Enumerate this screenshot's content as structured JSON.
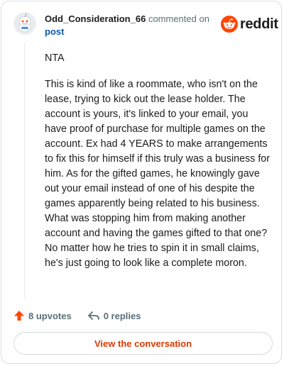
{
  "comment": {
    "username": "Odd_Consideration_66",
    "action_text": "commented on",
    "post_link": "post",
    "paragraphs": [
      "NTA",
      "This is kind of like a roommate, who isn't on the lease, trying to kick out the lease holder. The account is yours, it's linked to your email, you have proof of purchase for multiple games on the account. Ex had 4 YEARS to make arrangements to fix this for himself if this truly was a business for him. As for the gifted games, he knowingly gave out your email instead of one of his despite the games apparently being related to his business. What was stopping him from making another account and having the games gifted to that one? No matter how he tries to spin it in small claims, he's just going to look like a complete moron."
    ]
  },
  "brand": {
    "name": "reddit",
    "icon": "reddit-alien-icon",
    "color": "#ff4500"
  },
  "actions": {
    "upvotes": "8 upvotes",
    "replies": "0 replies",
    "upvote_icon": "upvote-arrow-icon",
    "reply_icon": "reply-arrow-icon",
    "upvote_color": "#ff4500"
  },
  "cta": {
    "label": "View the conversation",
    "color": "#d93900"
  }
}
